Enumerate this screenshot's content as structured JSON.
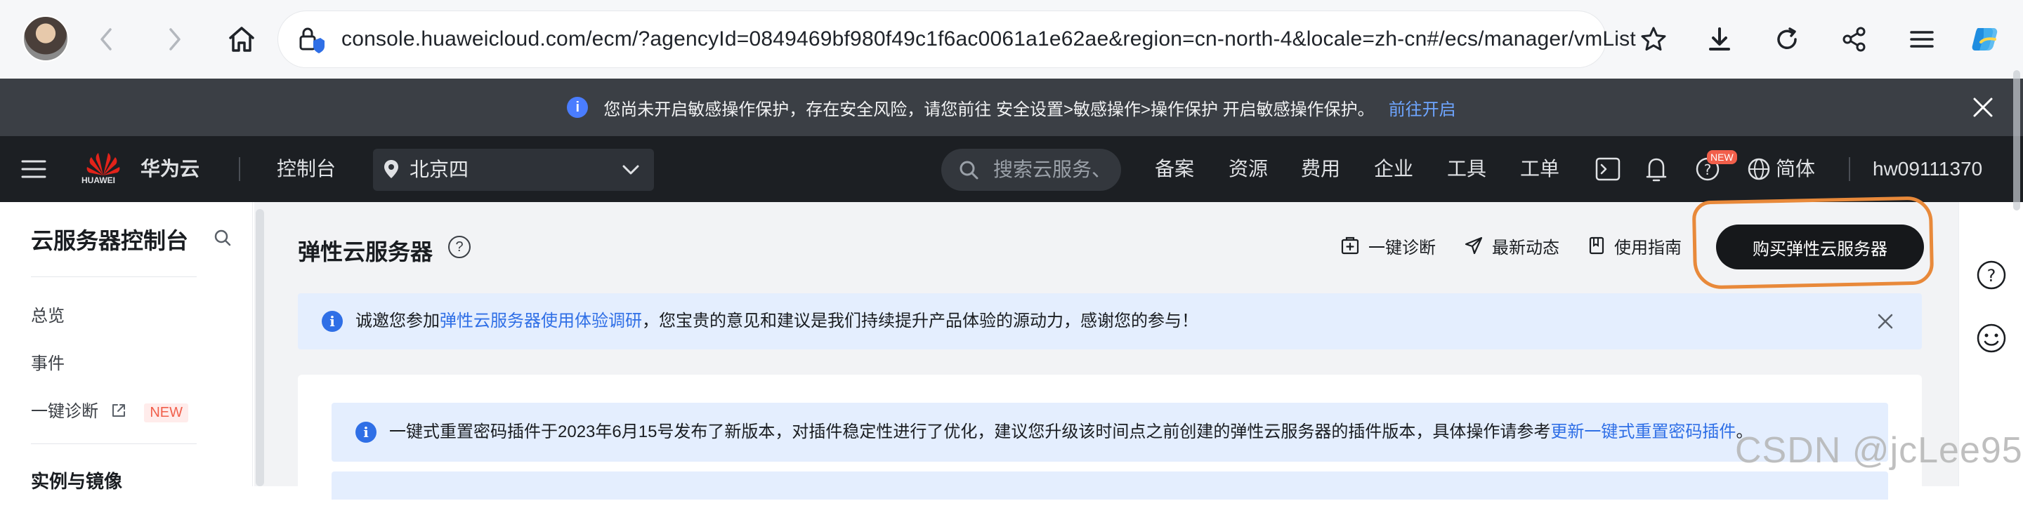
{
  "browser": {
    "url": "console.huaweicloud.com/ecm/?agencyId=0849469bf980f49c1f6ac0061a1e62ae&region=cn-north-4&locale=zh-cn#/ecs/manager/vmList"
  },
  "security_notice": {
    "text": "您尚未开启敏感操作保护，存在安全风险，请您前往 安全设置>敏感操作>操作保护 开启敏感操作保护。",
    "link": "前往开启"
  },
  "console_header": {
    "brand_sub": "HUAWEI",
    "brand_name": "华为云",
    "console_label": "控制台",
    "region": "北京四",
    "search_placeholder": "搜索云服务、",
    "nav": [
      "备案",
      "资源",
      "费用",
      "企业",
      "工具",
      "工单"
    ],
    "new_badge": "NEW",
    "language": "简体",
    "user": "hw09111370"
  },
  "sidebar": {
    "title": "云服务器控制台",
    "items": [
      {
        "label": "总览"
      },
      {
        "label": "事件"
      },
      {
        "label": "一键诊断",
        "tag": "NEW"
      }
    ],
    "section": "实例与镜像"
  },
  "main": {
    "title": "弹性云服务器",
    "actions": [
      "一键诊断",
      "最新动态",
      "使用指南"
    ],
    "buy_button": "购买弹性云服务器",
    "survey": {
      "prefix": "诚邀您参加",
      "link": "弹性云服务器使用体验调研",
      "suffix": "，您宝贵的意见和建议是我们持续提升产品体验的源动力，感谢您的参与！"
    },
    "plugin_notice": {
      "text": "一键式重置密码插件于2023年6月15号发布了新版本，对插件稳定性进行了优化，建议您升级该时间点之前创建的弹性云服务器的插件版本，具体操作请参考",
      "link": "更新一键式重置密码插件",
      "end": "。"
    }
  },
  "watermark": "CSDN @jcLee95",
  "colors": {
    "accent": "#2f6fe6",
    "header_bg": "#1c1f23",
    "highlight": "#e8893a",
    "brand_red": "#e2231a"
  }
}
